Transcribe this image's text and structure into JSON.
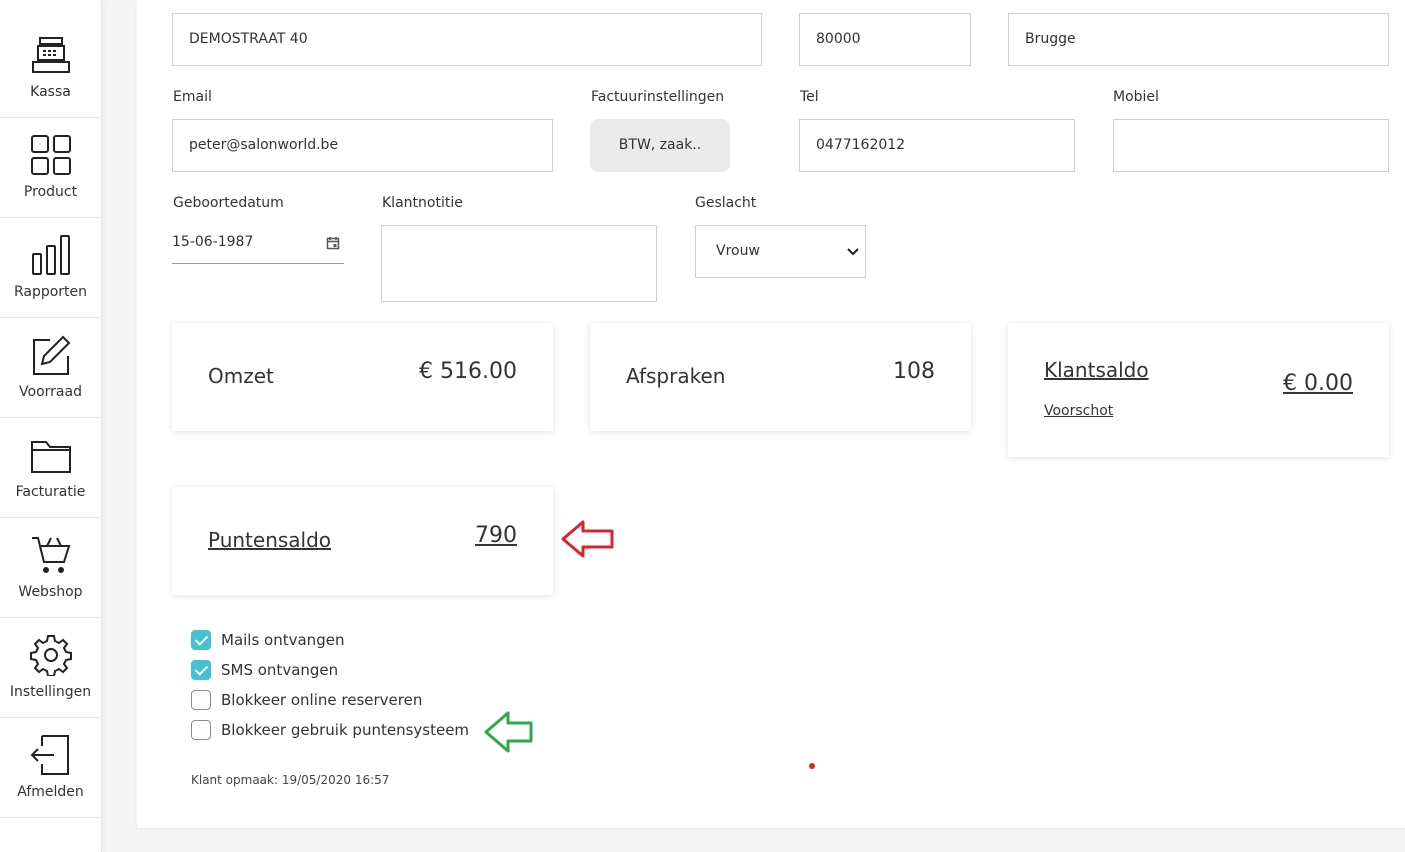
{
  "sidebar": {
    "items": [
      {
        "label": "Kassa",
        "icon": "cash-register-icon"
      },
      {
        "label": "Product",
        "icon": "grid-icon"
      },
      {
        "label": "Rapporten",
        "icon": "bar-chart-icon"
      },
      {
        "label": "Voorraad",
        "icon": "edit-icon"
      },
      {
        "label": "Facturatie",
        "icon": "folder-icon"
      },
      {
        "label": "Webshop",
        "icon": "cart-icon"
      },
      {
        "label": "Instellingen",
        "icon": "gear-icon"
      },
      {
        "label": "Afmelden",
        "icon": "logout-icon"
      }
    ]
  },
  "form": {
    "street": "DEMOSTRAAT 40",
    "postcode": "80000",
    "city": "Brugge",
    "email_label": "Email",
    "email": "peter@salonworld.be",
    "invoice_label": "Factuurinstellingen",
    "invoice_button": "BTW, zaak..",
    "tel_label": "Tel",
    "tel": "0477162012",
    "mobile_label": "Mobiel",
    "mobile": "",
    "birthdate_label": "Geboortedatum",
    "birthdate": "15-06-1987",
    "note_label": "Klantnotitie",
    "note": "",
    "gender_label": "Geslacht",
    "gender": "Vrouw"
  },
  "stats": {
    "omzet_label": "Omzet",
    "omzet_value": "€ 516.00",
    "afspraken_label": "Afspraken",
    "afspraken_value": "108",
    "klantsaldo_label": "Klantsaldo",
    "klantsaldo_value": "€ 0.00",
    "voorschot_label": "Voorschot",
    "punten_label": "Puntensaldo",
    "punten_value": "790"
  },
  "options": [
    {
      "label": "Mails ontvangen",
      "checked": true
    },
    {
      "label": "SMS ontvangen",
      "checked": true
    },
    {
      "label": "Blokkeer online reserveren",
      "checked": false
    },
    {
      "label": "Blokkeer gebruik puntensysteem",
      "checked": false
    }
  ],
  "footer": {
    "created": "Klant opmaak: 19/05/2020 16:57"
  },
  "colors": {
    "accent": "#45c2cf",
    "arrow_red": "#d9242b",
    "arrow_green": "#2fa84a"
  }
}
